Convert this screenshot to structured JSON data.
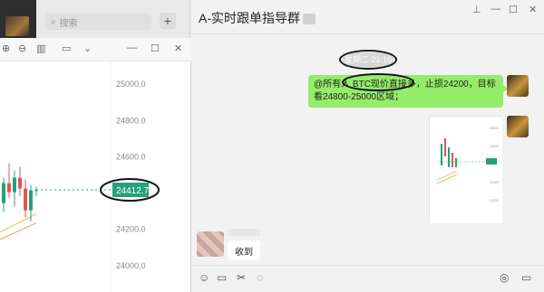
{
  "sidebar": {
    "search_placeholder": "搜索",
    "add_label": "+"
  },
  "chart_window": {
    "toolbar_icons": [
      "zoom-in-icon",
      "zoom-out-icon",
      "grid-icon",
      "window-icon",
      "chevron-down-icon",
      "minimize-icon",
      "maximize-icon",
      "close-icon"
    ],
    "minimize_label": "—",
    "maximize_label": "☐",
    "close_label": "✕"
  },
  "chart_data": {
    "type": "candlestick",
    "y_ticks": [
      "25000.0",
      "24800.0",
      "24600.0",
      "24412.7",
      "24200.0",
      "24000.0"
    ],
    "current_price": "24412.7",
    "ylim": [
      23850,
      25120
    ],
    "candles": [
      {
        "o": 24340,
        "h": 24480,
        "l": 24290,
        "c": 24450,
        "dir": "up"
      },
      {
        "o": 24450,
        "h": 24560,
        "l": 24370,
        "c": 24400,
        "dir": "down"
      },
      {
        "o": 24400,
        "h": 24520,
        "l": 24320,
        "c": 24480,
        "dir": "up"
      },
      {
        "o": 24480,
        "h": 24540,
        "l": 24380,
        "c": 24420,
        "dir": "down"
      },
      {
        "o": 24420,
        "h": 24470,
        "l": 24260,
        "c": 24300,
        "dir": "down"
      },
      {
        "o": 24300,
        "h": 24440,
        "l": 24240,
        "c": 24410,
        "dir": "up"
      },
      {
        "o": 24410,
        "h": 24430,
        "l": 24380,
        "c": 24412,
        "dir": "up"
      }
    ],
    "accent_color": "#26a17b",
    "down_color": "#e25555"
  },
  "chat": {
    "title": "A-实时跟单指导群",
    "window_controls": [
      "pin-icon",
      "minimize-icon",
      "maximize-icon",
      "close-icon"
    ],
    "pin_label": "⊥",
    "minimize_label": "—",
    "maximize_label": "☐",
    "close_label": "✕",
    "timestamp": "星期二 21:16",
    "sent_message": "@所有人 BTC现价直接多，止损24200，目标看24800-25000区域；",
    "received_message": "收到",
    "input_icons": [
      "emoji-icon",
      "folder-icon",
      "scissors-icon",
      "chat-bubble-icon",
      "phone-icon",
      "video-icon"
    ]
  }
}
